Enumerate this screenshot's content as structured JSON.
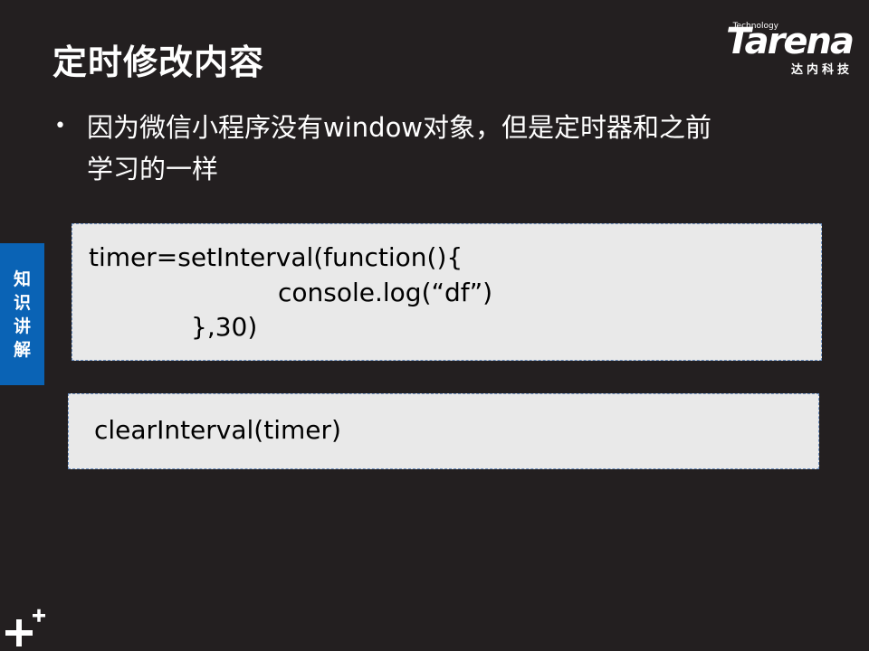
{
  "title": "定时修改内容",
  "logo": {
    "technology": "Technology",
    "brand": "Tarena",
    "cn": "达内科技"
  },
  "bullet": {
    "line1": "因为微信小程序没有window对象，但是定时器和之前",
    "line2": "学习的一样"
  },
  "side_tab": {
    "chars": [
      "知",
      "识",
      "讲",
      "解"
    ]
  },
  "code_box_1": {
    "lines": [
      "timer=setInterval(function(){",
      "console.log(“df”)",
      "},30)"
    ]
  },
  "code_box_2": {
    "lines": [
      "clearInterval(timer)"
    ]
  },
  "icons": {
    "corner": "plus-sparkle-icon"
  }
}
